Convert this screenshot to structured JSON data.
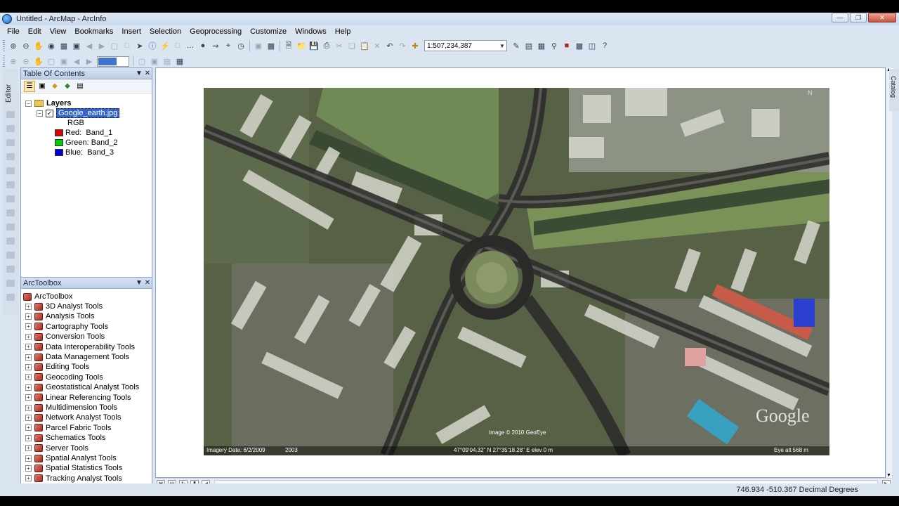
{
  "window": {
    "title": "Untitled - ArcMap - ArcInfo"
  },
  "menu": [
    "File",
    "Edit",
    "View",
    "Bookmarks",
    "Insert",
    "Selection",
    "Geoprocessing",
    "Customize",
    "Windows",
    "Help"
  ],
  "toolbar": {
    "scale": "1:507,234,387"
  },
  "editor_tab": "Editor",
  "catalog_tab": "Catalog",
  "toc": {
    "title": "Table Of Contents",
    "group": "Layers",
    "layer": "Google_earth.jpg",
    "renderer": "RGB",
    "bands": [
      {
        "label": "Red:",
        "band": "Band_1",
        "color": "#e00000"
      },
      {
        "label": "Green:",
        "band": "Band_2",
        "color": "#00d000"
      },
      {
        "label": "Blue:",
        "band": "Band_3",
        "color": "#0000e0"
      }
    ]
  },
  "toolbox": {
    "title": "ArcToolbox",
    "root": "ArcToolbox",
    "items": [
      "3D Analyst Tools",
      "Analysis Tools",
      "Cartography Tools",
      "Conversion Tools",
      "Data Interoperability Tools",
      "Data Management Tools",
      "Editing Tools",
      "Geocoding Tools",
      "Geostatistical Analyst Tools",
      "Linear Referencing Tools",
      "Multidimension Tools",
      "Network Analyst Tools",
      "Parcel Fabric Tools",
      "Schematics Tools",
      "Server Tools",
      "Spatial Analyst Tools",
      "Spatial Statistics Tools",
      "Tracking Analyst Tools"
    ]
  },
  "map": {
    "imagery_date": "Imagery Date: 6/2/2009",
    "year": "2003",
    "coords": "47°09'04.32\" N  27°35'18.28\" E  elev   0 m",
    "copyright": "Image © 2010 GeoEye",
    "google": "Google",
    "eye_alt": "Eye alt     568 m"
  },
  "status": {
    "coords": "746.934  -510.367 Decimal Degrees"
  }
}
